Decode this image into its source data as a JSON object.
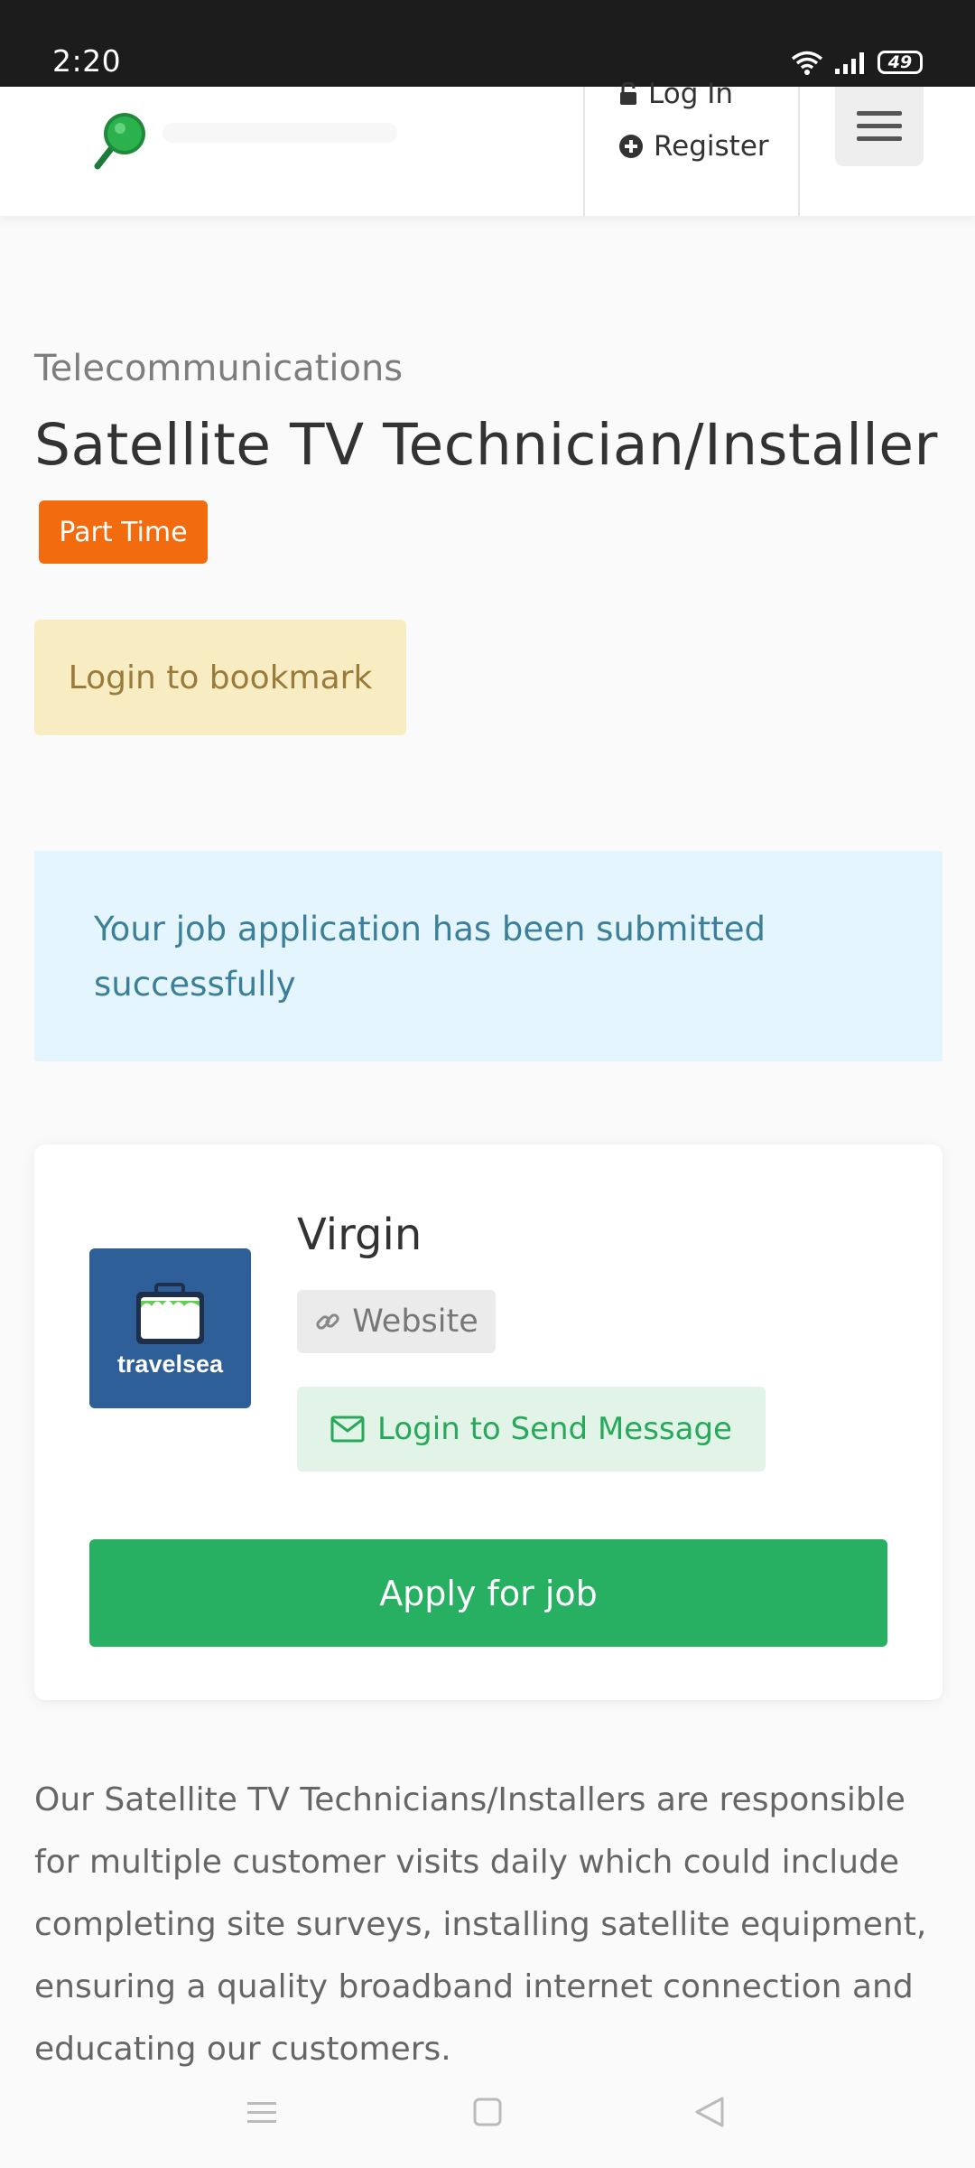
{
  "status_bar": {
    "time": "2:20",
    "battery": "49"
  },
  "header": {
    "login_label": "Log In",
    "register_label": "Register"
  },
  "job": {
    "category": "Telecommunications",
    "title": "Satellite TV Technician/Installer",
    "type_badge": "Part Time",
    "bookmark_label": "Login to bookmark",
    "alert_message": "Your job application has been submitted successfully",
    "description": "Our Satellite TV Technicians/Installers are responsible for multiple customer visits daily which could include completing site surveys, installing satellite equipment, ensuring a quality broadband internet connection and educating our customers."
  },
  "company": {
    "name": "Virgin",
    "logo_text": "travelsea",
    "website_label": "Website",
    "message_label": "Login to Send Message",
    "apply_label": "Apply for job"
  },
  "colors": {
    "badge": "#f26b0f",
    "apply": "#27b061",
    "alert_bg": "#e5f5fd",
    "bookmark_bg": "#f8edc2"
  },
  "icons": {
    "lock": "lock-icon",
    "register": "plus-circle-icon",
    "menu": "hamburger-icon",
    "website": "link-icon",
    "message": "envelope-icon"
  }
}
